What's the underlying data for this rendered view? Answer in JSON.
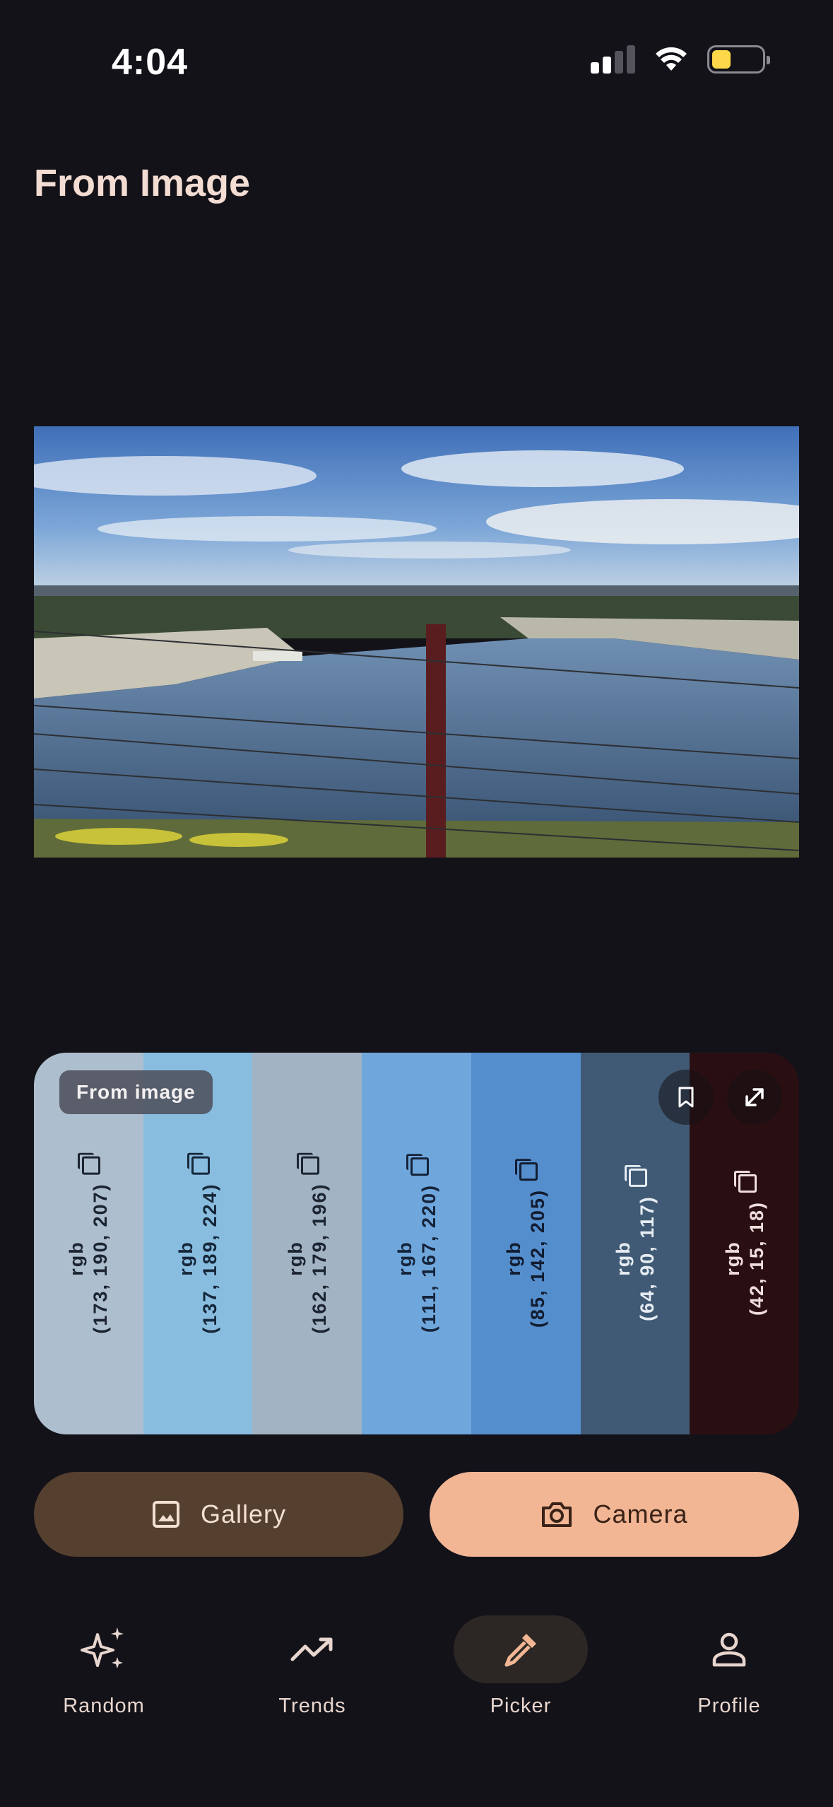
{
  "status_bar": {
    "time": "4:04"
  },
  "page": {
    "title": "From Image"
  },
  "palette": {
    "chip_label": "From image",
    "swatches": [
      {
        "prefix": "rgb",
        "value": "(173, 190, 207)",
        "color": "#adbecf",
        "text_color": "#1b2430"
      },
      {
        "prefix": "rgb",
        "value": "(137, 189, 224)",
        "color": "#89bde0",
        "text_color": "#16273a"
      },
      {
        "prefix": "rgb",
        "value": "(162, 179, 196)",
        "color": "#a2b3c4",
        "text_color": "#1b2430"
      },
      {
        "prefix": "rgb",
        "value": "(111, 167, 220)",
        "color": "#6fa7dc",
        "text_color": "#15233a"
      },
      {
        "prefix": "rgb",
        "value": "(85, 142, 205)",
        "color": "#558ecd",
        "text_color": "#121c30"
      },
      {
        "prefix": "rgb",
        "value": "(64, 90, 117)",
        "color": "#405a75",
        "text_color": "#e6ecf2"
      },
      {
        "prefix": "rgb",
        "value": "(42, 15, 18)",
        "color": "#2a0f12",
        "text_color": "#f0dede"
      }
    ]
  },
  "actions": {
    "gallery_label": "Gallery",
    "camera_label": "Camera"
  },
  "nav": {
    "items": [
      {
        "label": "Random",
        "icon": "sparkles-icon"
      },
      {
        "label": "Trends",
        "icon": "trending-up-icon"
      },
      {
        "label": "Picker",
        "icon": "eyedropper-icon",
        "active": true
      },
      {
        "label": "Profile",
        "icon": "person-icon"
      }
    ]
  },
  "colors": {
    "background": "#131219",
    "accent": "#f2b694",
    "title": "#f3dcd2"
  }
}
